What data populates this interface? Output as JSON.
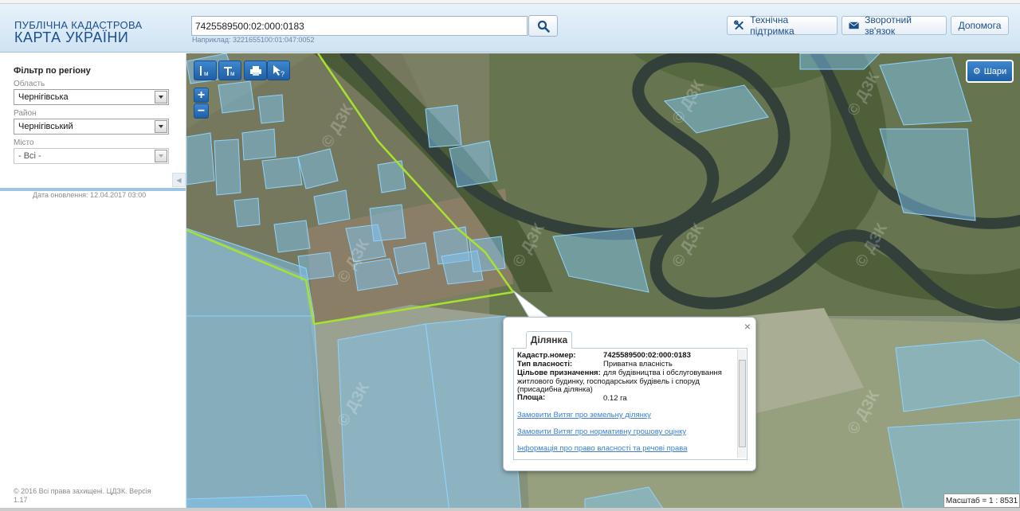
{
  "header": {
    "logo_line1": "ПУБЛІЧНА КАДАСТРОВА",
    "logo_line2": "КАРТА УКРАЇНИ",
    "search_value": "7425589500:02:000:0183",
    "search_hint": "Наприклад: 3221655100:01:047:0052",
    "support_label": "Технічна підтримка",
    "feedback_label": "Зворотний зв'язок",
    "help_label": "Допомога"
  },
  "sidebar": {
    "filter_title": "Фільтр по регіону",
    "oblast_label": "Область",
    "oblast_value": "Чернігівська",
    "rayon_label": "Район",
    "rayon_value": "Чернігівський",
    "misto_label": "Місто",
    "misto_value": "- Всі -",
    "update_date": "Дата оновлення: 12.04.2017 03:00",
    "copyright": "© 2016 Всі права захищені. ЦДЗК. Версія 1.17"
  },
  "map": {
    "layers_label": "Шари",
    "scale_text": "Масштаб = 1 : 8531",
    "watermark": "© ДЗК",
    "tools": [
      "measure-length-icon",
      "measure-area-icon",
      "print-icon",
      "identify-icon"
    ]
  },
  "popup": {
    "tab_label": "Ділянка",
    "cadastre_key": "Кадастр.номер:",
    "cadastre_value": "7425589500:02:000:0183",
    "ownership_key": "Тип власності:",
    "ownership_value": "Приватна власність",
    "purpose_key": "Цільове призначення:",
    "purpose_value_line1": "для будівництва і обслуговування",
    "purpose_value_line2": "житлового будинку, господарських будівель і споруд",
    "purpose_value_line3": "(присадибна ділянка)",
    "area_key": "Площа:",
    "area_value": "0.12 га",
    "link1": "Замовити Витяг про земельну ділянку",
    "link2": "Замовити Витяг про нормативну грошову оцінку",
    "link3": "Інформація про право власності та речові права"
  },
  "colors": {
    "accent": "#1f5fa6",
    "parcel_fill": "#7fc3f0",
    "boundary_line": "#a6e22e",
    "river": "#3b4a3a"
  }
}
